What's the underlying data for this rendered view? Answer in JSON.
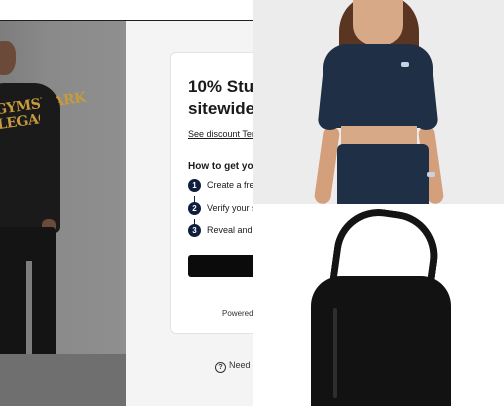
{
  "promo_card": {
    "title_line1": "10% Stu",
    "title_line2": "sitewide",
    "terms_link": "See discount Term",
    "how_heading": "How to get yo",
    "steps": [
      {
        "num": "1",
        "text": "Create a free"
      },
      {
        "num": "2",
        "text": "Verify your s"
      },
      {
        "num": "3",
        "text": "Reveal and c"
      }
    ],
    "cta_label": "",
    "powered_by": "Powered"
  },
  "help": {
    "icon": "?",
    "text": "Need"
  },
  "colors": {
    "step_badge": "#0f1e3d",
    "cta": "#0b0b0b",
    "top_navy": "#1f2f45"
  }
}
